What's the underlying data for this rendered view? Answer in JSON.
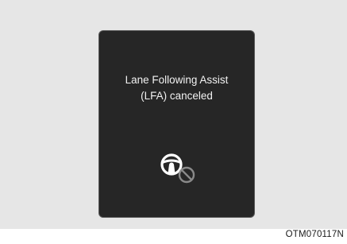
{
  "display": {
    "message_line1": "Lane Following Assist",
    "message_line2": "(LFA) canceled",
    "icon": "steering-wheel-canceled-icon",
    "colors": {
      "screen_background": "#262626",
      "text": "#f2f2f2",
      "icon_wheel": "#ffffff",
      "icon_cancel": "#8a8a8a",
      "page_background": "#e6e6e6"
    }
  },
  "figure": {
    "code": "OTM070117N"
  }
}
